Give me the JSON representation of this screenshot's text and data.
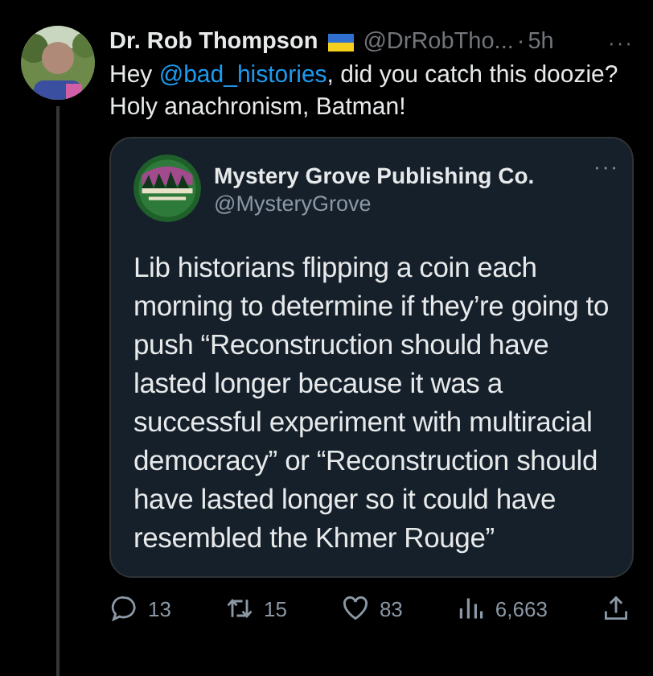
{
  "tweet": {
    "name": "Dr. Rob Thompson",
    "handle": "@DrRobTho...",
    "separator": "·",
    "time": "5h",
    "more": "···",
    "text_before": "Hey ",
    "mention": "@bad_histories",
    "text_after": ", did you catch this doozie? Holy anachronism, Batman!",
    "quote": {
      "name": "Mystery Grove Publishing Co.",
      "handle": "@MysteryGrove",
      "more": "···",
      "text": "Lib historians flipping a coin each morning to determine if they’re going to push “Reconstruction should have lasted longer because it was a successful experiment with multiracial democracy” or “Reconstruction should have lasted longer so it could have resembled the Khmer Rouge”"
    },
    "actions": [
      {
        "kind": "reply",
        "count": "13"
      },
      {
        "kind": "retweet",
        "count": "15"
      },
      {
        "kind": "like",
        "count": "83"
      },
      {
        "kind": "views",
        "count": "6,663"
      },
      {
        "kind": "share"
      }
    ]
  }
}
